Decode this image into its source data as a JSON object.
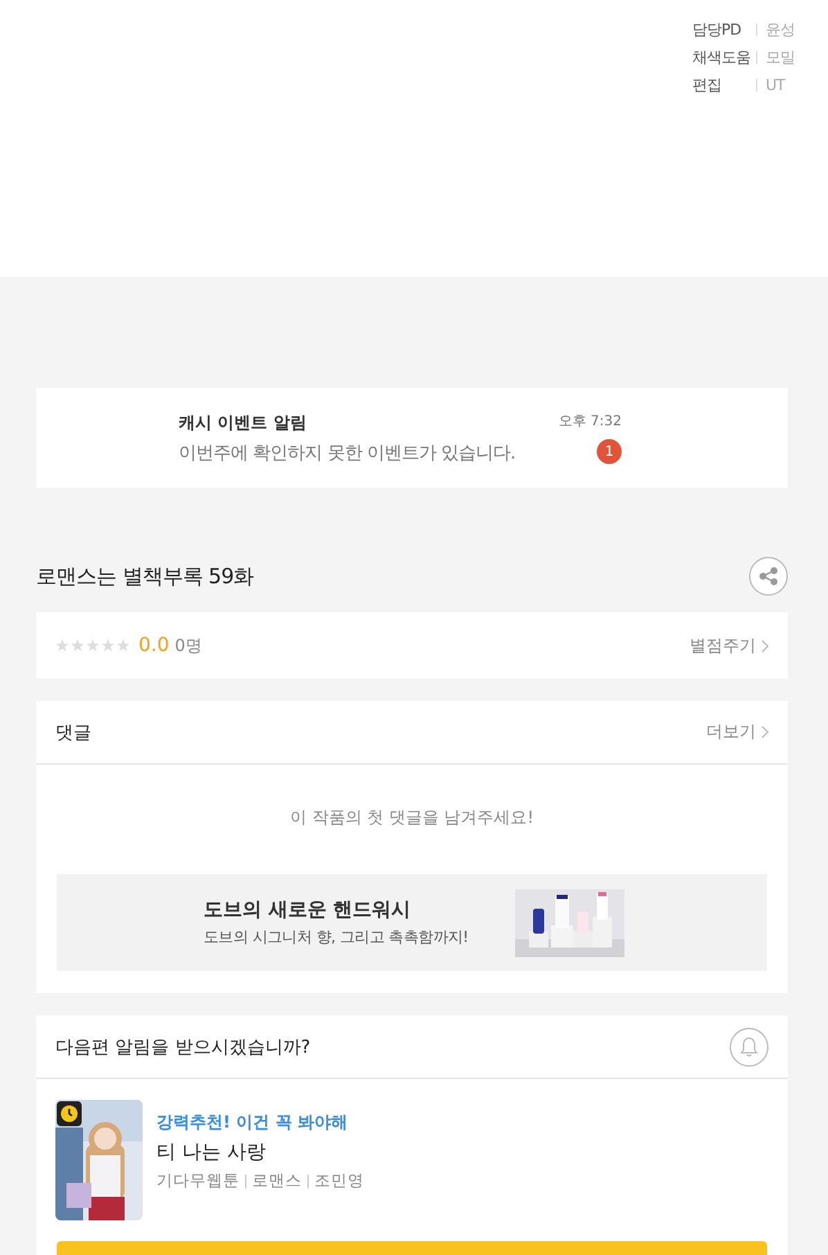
{
  "credits": [
    {
      "role": "담당PD",
      "name": "윤성"
    },
    {
      "role": "채색도움",
      "name": "모밀"
    },
    {
      "role": "편집",
      "name": "UT"
    }
  ],
  "notice": {
    "title": "캐시 이벤트 알림",
    "message": "이번주에 확인하지 못한 이벤트가 있습니다.",
    "time": "오후 7:32",
    "badge": "1"
  },
  "episode": {
    "title": "로맨스는 별책부록 59화"
  },
  "rating": {
    "stars": 0,
    "score": "0.0",
    "count": "0명",
    "action": "별점주기"
  },
  "comments": {
    "title": "댓글",
    "more": "더보기",
    "empty": "이 작품의 첫 댓글을 남겨주세요!"
  },
  "ad": {
    "title": "도브의 새로운 핸드워시",
    "subtitle": "도브의 시그니처 향, 그리고 촉촉함까지!"
  },
  "next": {
    "question": "다음편 알림을 받으시겠습니까?",
    "tagline": "강력추천! 이건 꼭 봐야해",
    "title": "티 나는 사랑",
    "meta": [
      "기다무웹툰",
      "로맨스",
      "조민영"
    ]
  }
}
